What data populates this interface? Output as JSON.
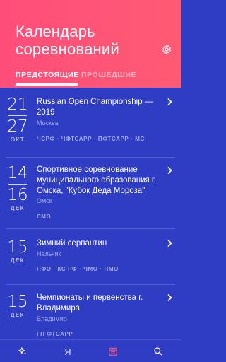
{
  "header": {
    "title_line1": "Календарь",
    "title_line2": "соревнований",
    "settings_icon": "gear-icon",
    "tabs": [
      {
        "label": "ПРЕДСТОЯЩИЕ",
        "active": true
      },
      {
        "label": "ПРОШЕДШИЕ",
        "active": false
      }
    ]
  },
  "events": [
    {
      "day_start": "21",
      "day_end": "27",
      "month": "ОКТ",
      "name": "Russian Open Championship — 2019",
      "city": "Москва",
      "tags": "ЧСРФ · ЧФТСАРР · ПФТСАРР · МС"
    },
    {
      "day_start": "14",
      "day_end": "16",
      "month": "ДЕК",
      "name": "Спортивное соревнование муниципального образования г. Омска, \"Кубок Деда Мороза\"",
      "city": "Омск",
      "tags": "СМО"
    },
    {
      "day_start": "15",
      "month": "ДЕК",
      "name": "Зимний серпантин",
      "city": "Нальчик",
      "tags": "ПФО · КС РФ · ЧМО · ПМО"
    },
    {
      "day_start": "15",
      "month": "ДЕК",
      "name": "Чемпионаты и первенства г. Владимира",
      "city": "Владимир",
      "tags": "ГП ФТСАРР"
    }
  ],
  "bottom_nav": {
    "items": [
      {
        "icon": "sparkle-icon"
      },
      {
        "label": "Я"
      },
      {
        "icon": "calendar-icon",
        "active": true
      },
      {
        "icon": "search-icon"
      }
    ]
  },
  "colors": {
    "header_bg": "#ff4e7a",
    "list_bg": "#2f3cc4",
    "active_nav": "#ff4e7a"
  }
}
